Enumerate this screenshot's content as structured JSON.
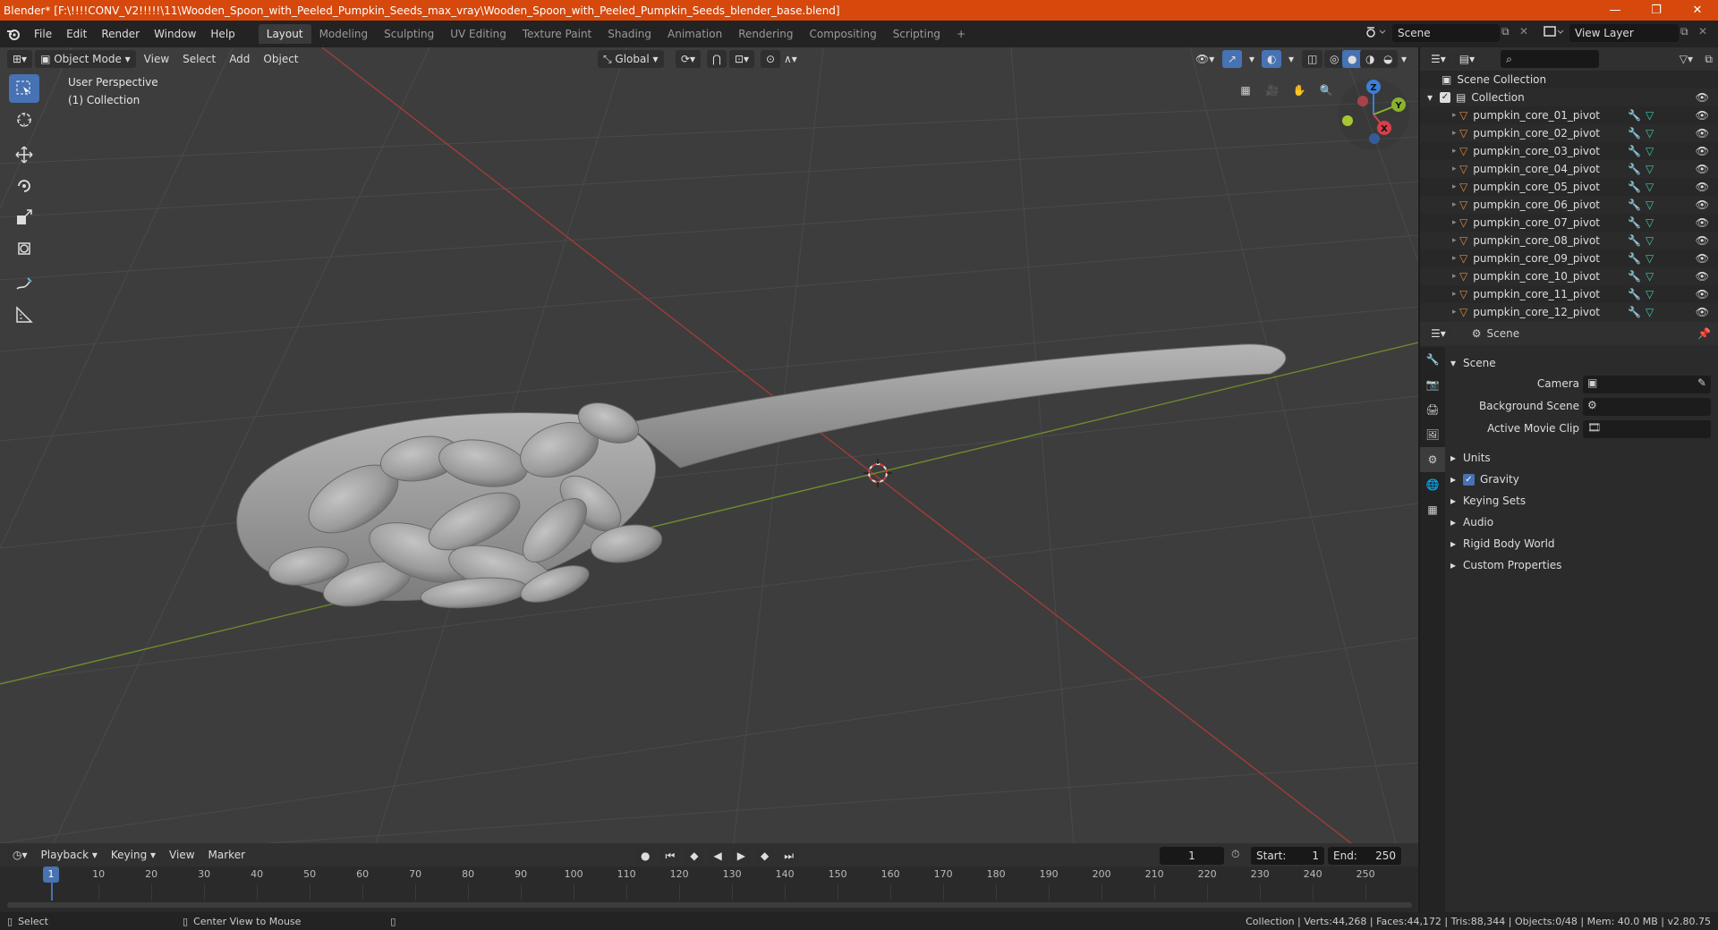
{
  "window": {
    "title": "Blender* [F:\\!!!!CONV_V2!!!!!\\11\\Wooden_Spoon_with_Peeled_Pumpkin_Seeds_max_vray\\Wooden_Spoon_with_Peeled_Pumpkin_Seeds_blender_base.blend]",
    "minimize": "—",
    "maximize": "❐",
    "close": "✕",
    "accent": "#d6480c"
  },
  "menu": [
    "File",
    "Edit",
    "Render",
    "Window",
    "Help"
  ],
  "workspaces": [
    "Layout",
    "Modeling",
    "Sculpting",
    "UV Editing",
    "Texture Paint",
    "Shading",
    "Animation",
    "Rendering",
    "Compositing",
    "Scripting"
  ],
  "workspace_add": "+",
  "scene_field": "Scene",
  "view_layer_field": "View Layer",
  "viewport": {
    "mode": "Object Mode",
    "menus": [
      "View",
      "Select",
      "Add",
      "Object"
    ],
    "transform_orientation": "Global",
    "overlay_label": "User Perspective",
    "collection_label": "(1) Collection",
    "gizmo": {
      "z": "Z",
      "y": "Y",
      "x": "X"
    }
  },
  "outliner": {
    "scene_collection": "Scene Collection",
    "collection": "Collection",
    "items": [
      "pumpkin_core_01_pivot",
      "pumpkin_core_02_pivot",
      "pumpkin_core_03_pivot",
      "pumpkin_core_04_pivot",
      "pumpkin_core_05_pivot",
      "pumpkin_core_06_pivot",
      "pumpkin_core_07_pivot",
      "pumpkin_core_08_pivot",
      "pumpkin_core_09_pivot",
      "pumpkin_core_10_pivot",
      "pumpkin_core_11_pivot",
      "pumpkin_core_12_pivot"
    ]
  },
  "properties": {
    "context": "Scene",
    "panel_title": "Scene",
    "camera_label": "Camera",
    "background_label": "Background Scene",
    "movie_clip_label": "Active Movie Clip",
    "subpanels": [
      "Units",
      "Gravity",
      "Keying Sets",
      "Audio",
      "Rigid Body World",
      "Custom Properties"
    ],
    "gravity_checked": true
  },
  "timeline": {
    "menus": [
      "Playback",
      "Keying",
      "View",
      "Marker"
    ],
    "current_frame": "1",
    "start_label": "Start:",
    "start_value": "1",
    "end_label": "End:",
    "end_value": "250",
    "ruler": [
      "10",
      "20",
      "30",
      "40",
      "50",
      "60",
      "70",
      "80",
      "90",
      "100",
      "110",
      "120",
      "130",
      "140",
      "150",
      "160",
      "170",
      "180",
      "190",
      "200",
      "210",
      "220",
      "230",
      "240",
      "250"
    ],
    "playhead": "1"
  },
  "status": {
    "select": "Select",
    "center_view": "Center View to Mouse",
    "stats": "Collection | Verts:44,268 | Faces:44,172 | Tris:88,344 | Objects:0/48 | Mem: 40.0 MB | v2.80.75"
  }
}
